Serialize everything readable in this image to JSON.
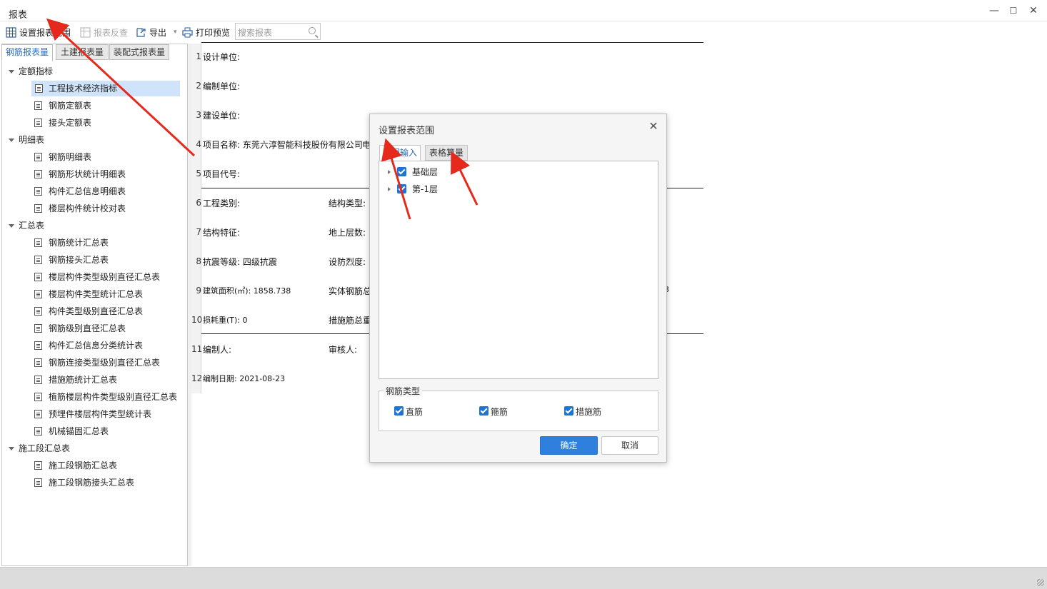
{
  "window": {
    "title": "报表",
    "minimize": "—",
    "maximize": "☐",
    "close": "✕"
  },
  "toolbar": {
    "set_range": "设置报表范围",
    "reverse_check": "报表反查",
    "export": "导出",
    "export_caret": "▾",
    "print_preview": "打印预览",
    "search_placeholder": "搜索报表"
  },
  "left_tabs": [
    "钢筋报表量",
    "土建报表量",
    "装配式报表量"
  ],
  "tree": {
    "groups": [
      {
        "label": "定额指标",
        "items": [
          "工程技术经济指标",
          "钢筋定额表",
          "接头定额表"
        ]
      },
      {
        "label": "明细表",
        "items": [
          "钢筋明细表",
          "钢筋形状统计明细表",
          "构件汇总信息明细表",
          "楼层构件统计校对表"
        ]
      },
      {
        "label": "汇总表",
        "items": [
          "钢筋统计汇总表",
          "钢筋接头汇总表",
          "楼层构件类型级别直径汇总表",
          "楼层构件类型统计汇总表",
          "构件类型级别直径汇总表",
          "钢筋级别直径汇总表",
          "构件汇总信息分类统计表",
          "钢筋连接类型级别直径汇总表",
          "措施筋统计汇总表",
          "植筋楼层构件类型级别直径汇总表",
          "预埋件楼层构件类型统计表",
          "机械锚固汇总表"
        ]
      },
      {
        "label": "施工段汇总表",
        "items": [
          "施工段钢筋汇总表",
          "施工段钢筋接头汇总表"
        ]
      }
    ],
    "selected": "工程技术经济指标"
  },
  "report": {
    "row_numbers": [
      "1",
      "2",
      "3",
      "4",
      "5",
      "6",
      "7",
      "8",
      "9",
      "10",
      "11",
      "12"
    ],
    "design_unit": "设计单位:",
    "compile_unit": "编制单位:",
    "build_unit": "建设单位:",
    "project_name": "项目名称: 东莞六淳智能科技股份有限公司",
    "project_name_tail": "电",
    "project_code": "项目代号:",
    "eng_type": "工程类别:",
    "struct_type": "结构类型:",
    "struct_feature": "结构特征:",
    "above_floors": "地上层数:",
    "seismic_grade": "抗震等级: 四级抗震",
    "fortify": "设防烈度:",
    "area": "建筑面积(㎡): 1858.738",
    "entity_total": "实体钢筋总",
    "tail_digit": "3",
    "loss_weight": "损耗重(T): 0",
    "measure_total": "措施筋总重",
    "compiler": "编制人:",
    "reviewer": "审核人:",
    "compile_date": "编制日期: 2021-08-23"
  },
  "dialog": {
    "title": "设置报表范围",
    "close": "✕",
    "tabs": [
      "绘图输入",
      "表格算量"
    ],
    "floors": [
      "基础层",
      "第-1层"
    ],
    "rebar_type_legend": "钢筋类型",
    "rebar_types": [
      "直筋",
      "箍筋",
      "措施筋"
    ],
    "ok": "确定",
    "cancel": "取消"
  },
  "colors": {
    "accent": "#2f7fde",
    "annotation_arrow": "#e5291d",
    "selected_row": "#cfe4fa"
  }
}
